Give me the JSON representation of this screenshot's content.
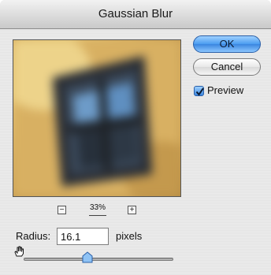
{
  "window": {
    "title": "Gaussian Blur"
  },
  "buttons": {
    "ok": "OK",
    "cancel": "Cancel"
  },
  "preview_option": {
    "label": "Preview",
    "checked": true
  },
  "zoom": {
    "level": "33%",
    "zoom_out_symbol": "−",
    "zoom_in_symbol": "+"
  },
  "radius": {
    "label": "Radius:",
    "value": "16.1",
    "units": "pixels"
  },
  "slider": {
    "value": 16.1
  },
  "colors": {
    "accent": "#3a86e0",
    "title_bar": "#d8d8d8"
  }
}
